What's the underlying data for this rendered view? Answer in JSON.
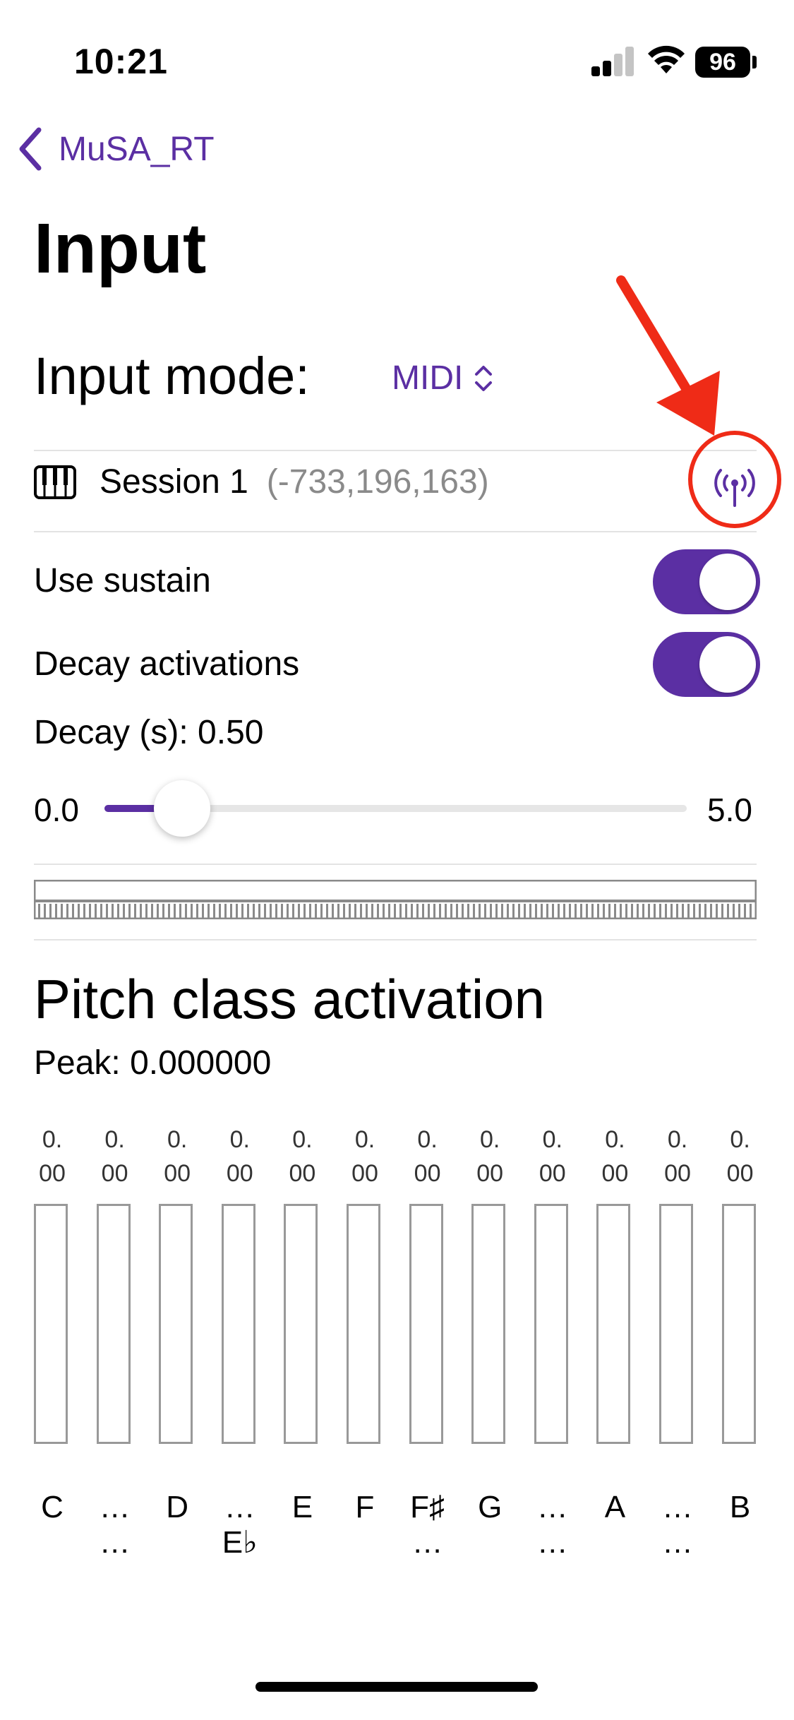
{
  "status": {
    "time": "10:21",
    "battery": "96"
  },
  "nav": {
    "back_label": "MuSA_RT"
  },
  "page": {
    "title": "Input"
  },
  "input_mode": {
    "label": "Input mode:",
    "value": "MIDI"
  },
  "session": {
    "name": "Session 1",
    "detail": "(-733,196,163)"
  },
  "settings": {
    "use_sustain": {
      "label": "Use sustain",
      "on": true
    },
    "decay_activations": {
      "label": "Decay activations",
      "on": true
    },
    "decay_label": "Decay (s): 0.50",
    "slider": {
      "min": "0.0",
      "max": "5.0",
      "value": 0.5
    }
  },
  "pitch": {
    "title": "Pitch class activation",
    "peak": "Peak: 0.000000",
    "columns": [
      {
        "v1": "0.",
        "v2": "00",
        "l1": "C",
        "l2": ""
      },
      {
        "v1": "0.",
        "v2": "00",
        "l1": "…",
        "l2": "…"
      },
      {
        "v1": "0.",
        "v2": "00",
        "l1": "D",
        "l2": ""
      },
      {
        "v1": "0.",
        "v2": "00",
        "l1": "…",
        "l2": "E♭"
      },
      {
        "v1": "0.",
        "v2": "00",
        "l1": "E",
        "l2": ""
      },
      {
        "v1": "0.",
        "v2": "00",
        "l1": "F",
        "l2": ""
      },
      {
        "v1": "0.",
        "v2": "00",
        "l1": "F♯",
        "l2": "…"
      },
      {
        "v1": "0.",
        "v2": "00",
        "l1": "G",
        "l2": ""
      },
      {
        "v1": "0.",
        "v2": "00",
        "l1": "…",
        "l2": "…"
      },
      {
        "v1": "0.",
        "v2": "00",
        "l1": "A",
        "l2": ""
      },
      {
        "v1": "0.",
        "v2": "00",
        "l1": "…",
        "l2": "…"
      },
      {
        "v1": "0.",
        "v2": "00",
        "l1": "B",
        "l2": ""
      }
    ]
  },
  "colors": {
    "accent": "#5b2fa3",
    "annotation": "#ef2b17"
  }
}
